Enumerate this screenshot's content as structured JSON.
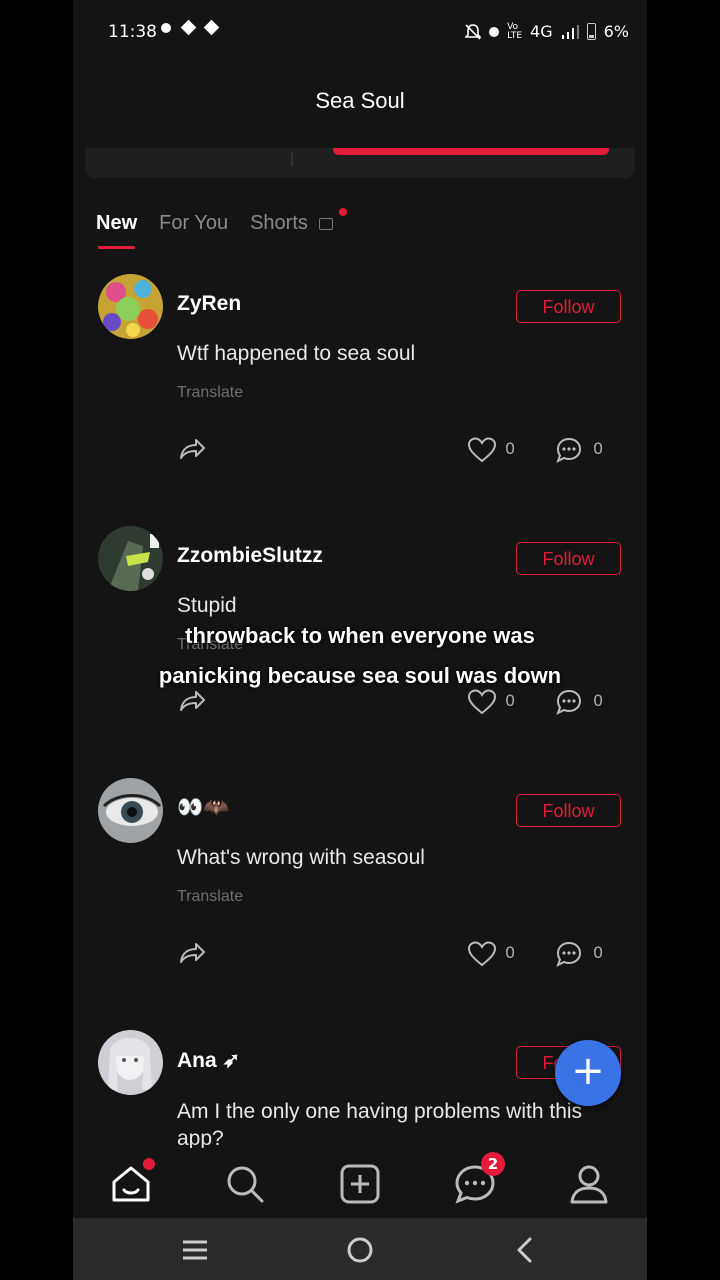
{
  "status_bar": {
    "time": "11:38",
    "network": "4G",
    "battery": "6%"
  },
  "header": {
    "title": "Sea Soul"
  },
  "tabs": [
    {
      "label": "New",
      "active": true
    },
    {
      "label": "For You",
      "active": false
    },
    {
      "label": "Shorts",
      "active": false
    }
  ],
  "posts": [
    {
      "username": "ZyRen",
      "content": "Wtf happened to sea soul",
      "translate": "Translate",
      "follow": "Follow",
      "likes": "0",
      "comments": "0"
    },
    {
      "username": "ZzombieSlutzz",
      "content": "Stupid",
      "translate": "Translate",
      "follow": "Follow",
      "likes": "0",
      "comments": "0"
    },
    {
      "username": "👀🦇",
      "content": "What's wrong with seasoul",
      "translate": "Translate",
      "follow": "Follow",
      "likes": "0",
      "comments": "0"
    },
    {
      "username": "Ana ➶",
      "content": "Am I the only one having problems with this app?",
      "follow": "Follow"
    }
  ],
  "caption": {
    "line1": "throwback to when everyone was",
    "line2": "panicking because sea soul was down"
  },
  "fab": {
    "label": "+"
  },
  "bottom_nav": {
    "messages_badge": "2"
  },
  "colors": {
    "accent": "#e31b3a",
    "fab": "#3a73e6",
    "background": "#141414"
  }
}
